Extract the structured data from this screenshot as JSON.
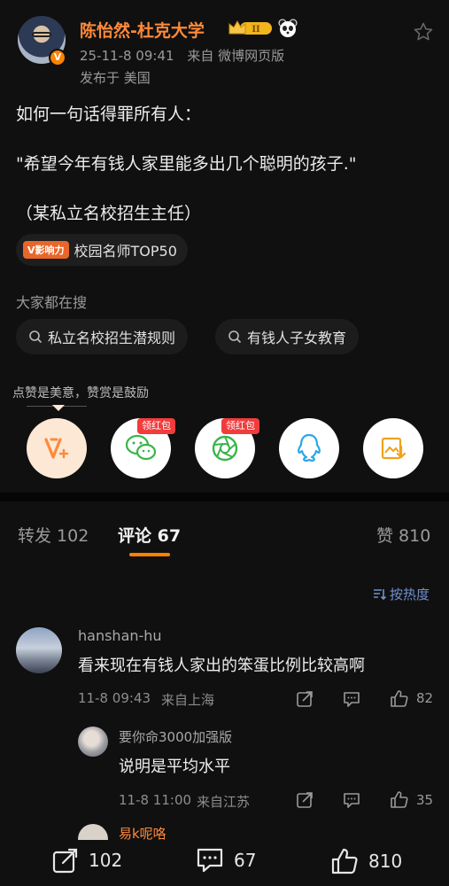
{
  "post": {
    "user_name": "陈怡然-杜克大学",
    "verified_letter": "V",
    "crown_level": "II",
    "timestamp": "25-11-8 09:41",
    "source": "来自 微博网页版",
    "location": "发布于 美国",
    "lines": [
      "如何一句话得罪所有人：",
      "\"希望今年有钱人家里能多出几个聪明的孩子.\"",
      "（某私立名校招生主任）"
    ],
    "topic_tag": "V影响力",
    "topic_label": "校园名师TOP50"
  },
  "search": {
    "title": "大家都在搜",
    "items": [
      "私立名校招生潜规则",
      "有钱人子女教育"
    ]
  },
  "actions": {
    "hint": "点赞是美意，赞赏是鼓励",
    "red_packet": "领红包"
  },
  "tabs": {
    "repost": "转发 102",
    "comment": "评论 67",
    "like": "赞 810"
  },
  "sort_label": "按热度",
  "comments": [
    {
      "name": "hanshan-hu",
      "text": "看来现在有钱人家出的笨蛋比例比较高啊",
      "time": "11-8 09:43",
      "place": "来自上海",
      "likes": "82"
    },
    {
      "name": "要你命3000加强版",
      "text": "说明是平均水平",
      "time": "11-8 11:00",
      "place": "来自江苏",
      "likes": "35"
    }
  ],
  "partial_name": "易k呢咯",
  "bottom": {
    "repost": "102",
    "comment": "67",
    "like": "810"
  },
  "colors": {
    "accent": "#ff8200",
    "name": "#ff8a3a",
    "sort": "#6f8fcf",
    "red_tag": "#f03c3c"
  }
}
